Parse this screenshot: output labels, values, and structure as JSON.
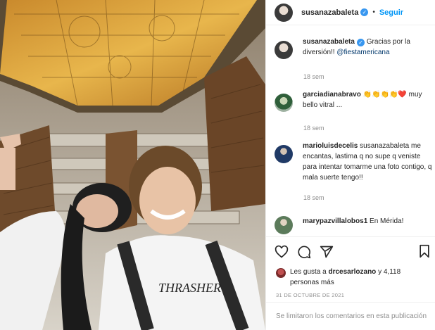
{
  "post": {
    "author": "susanazabaleta",
    "follow_label": "Seguir",
    "separator": "•"
  },
  "photo": {
    "shirt_text": "THRASHER"
  },
  "comments": [
    {
      "user": "susanazabaleta",
      "text": "Gracias por la diversión!! ",
      "mention": "@fiestamericana",
      "time": "18 sem"
    },
    {
      "user": "garciadianabravo",
      "text": "👏👏👏👏❤️ muy bello vitral ...",
      "time": "18 sem"
    },
    {
      "user": "marioluisdecelis",
      "text": "susanazabaleta me encantas, lastima q no supe q veniste para intentar tomarme una foto contigo, q mala suerte tengo!!",
      "time": "18 sem"
    },
    {
      "user": "marypazvillalobos1",
      "text": "En Mérida!"
    }
  ],
  "actions": {
    "likes_prefix": "Les gusta a ",
    "likes_user": "drcesarlozano",
    "likes_suffix": " y 4,118 personas más",
    "date": "31 DE OCTUBRE DE 2021",
    "comments_disabled": "Se limitaron los comentarios en esta publicación"
  },
  "icons": [
    "heart-icon",
    "comment-icon",
    "share-icon",
    "bookmark-icon",
    "verified-icon"
  ],
  "colors": {
    "accent": "#0095f6",
    "verified": "#3897f0",
    "muted": "#8e8e8e"
  }
}
